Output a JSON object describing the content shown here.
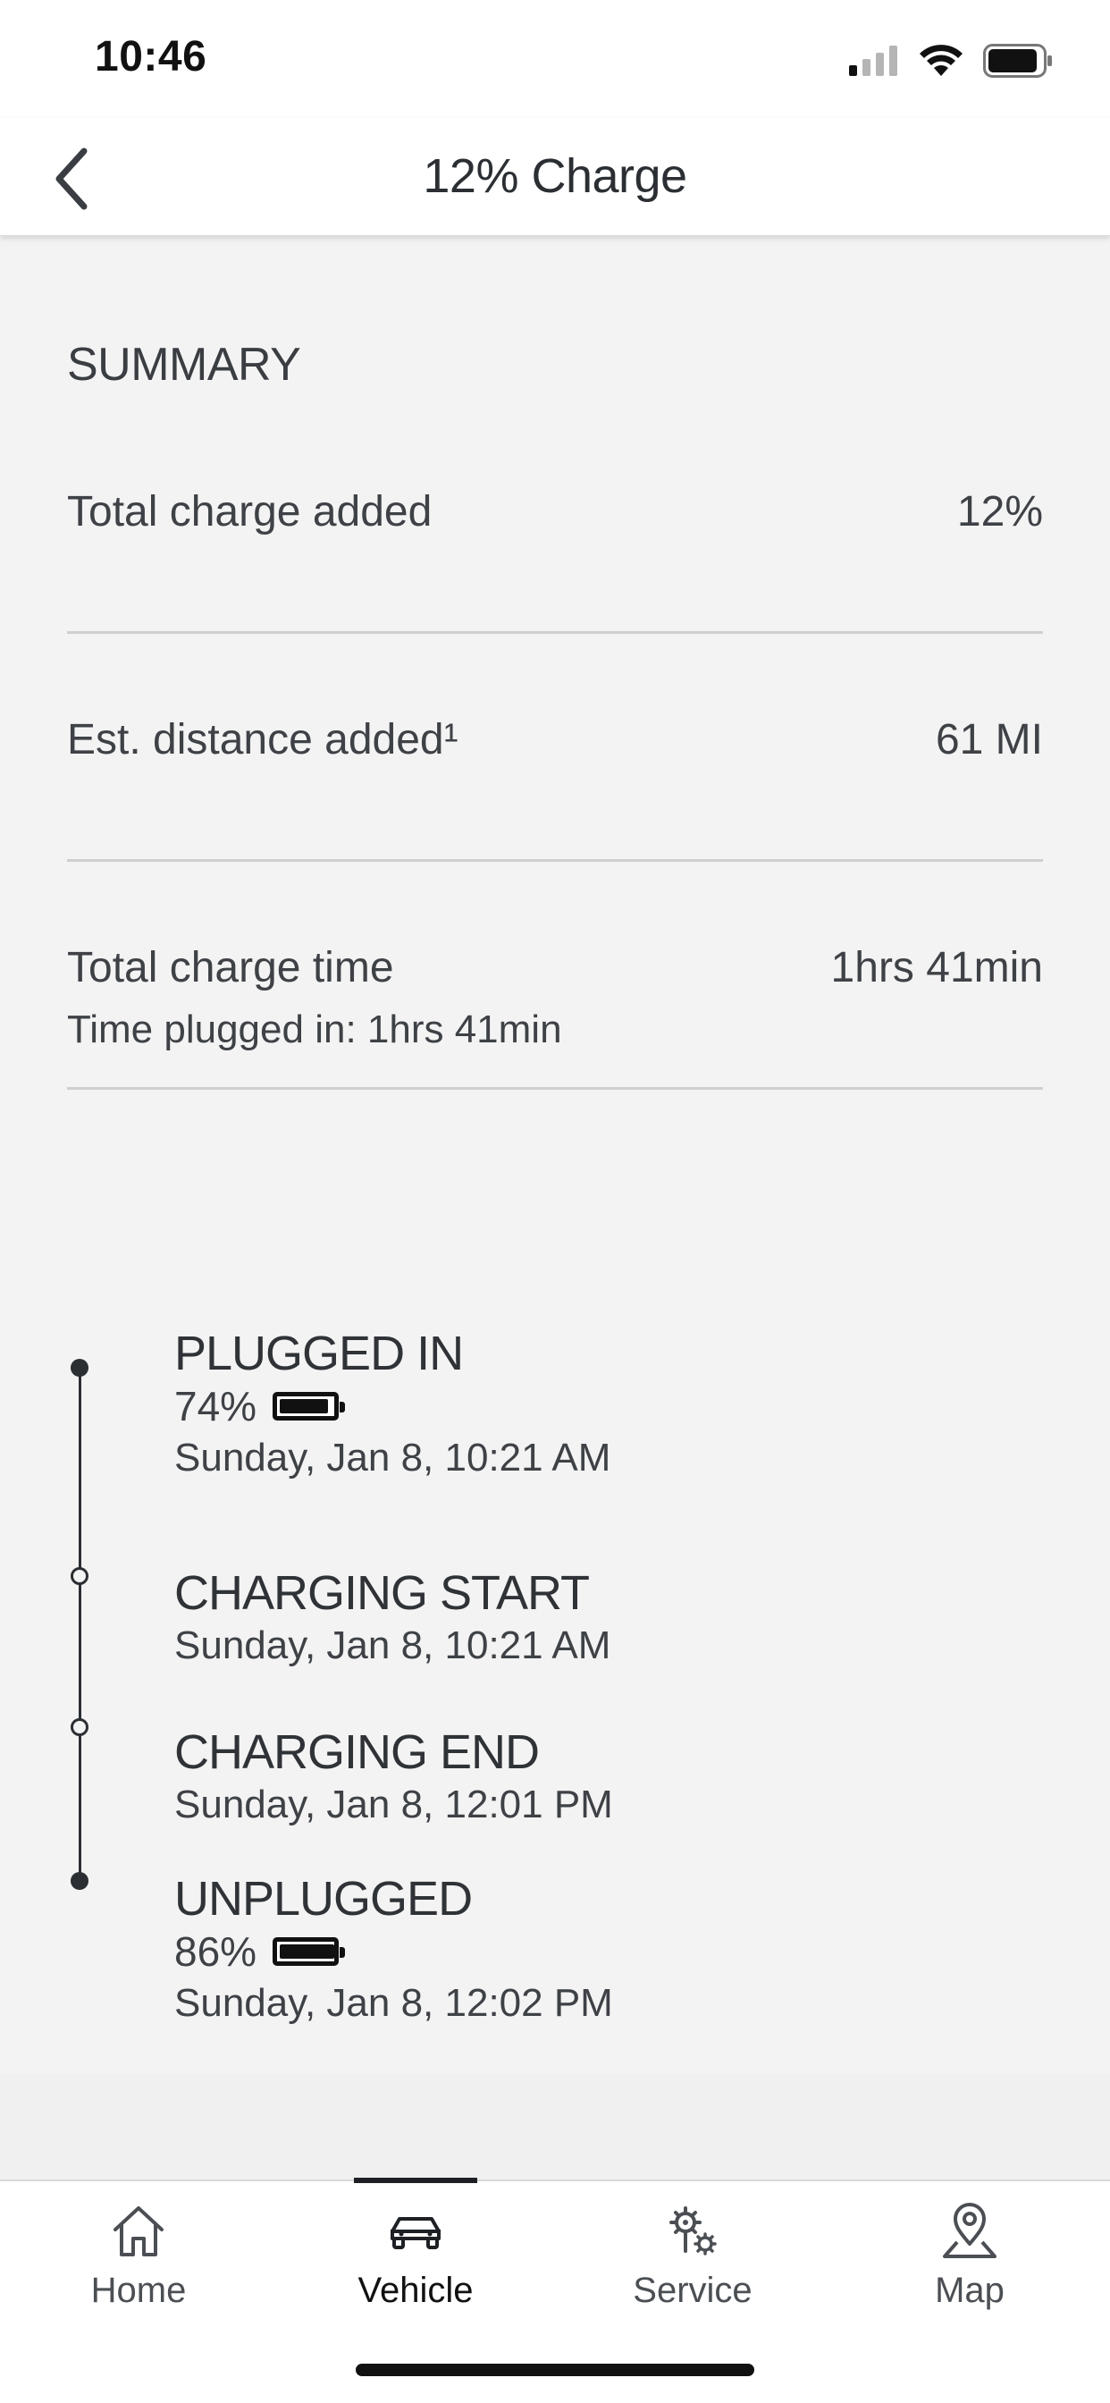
{
  "status_bar": {
    "time": "10:46",
    "icons": [
      "signal-icon",
      "wifi-icon",
      "battery-icon"
    ]
  },
  "header": {
    "title": "12% Charge",
    "back_icon": "chevron-left-icon"
  },
  "summary": {
    "title": "SUMMARY",
    "rows": [
      {
        "label": "Total charge added",
        "value": "12%"
      },
      {
        "label": "Est. distance added¹",
        "value": "61 MI"
      },
      {
        "label": "Total charge time",
        "value": "1hrs 41min",
        "sub": "Time plugged in: 1hrs 41min"
      }
    ]
  },
  "timeline": [
    {
      "title": "PLUGGED IN",
      "percent": "74%",
      "battery_level": 0.74,
      "time": "Sunday, Jan 8, 10:21 AM",
      "marker": "filled"
    },
    {
      "title": "CHARGING START",
      "time": "Sunday, Jan 8, 10:21 AM",
      "marker": "hollow"
    },
    {
      "title": "CHARGING END",
      "time": "Sunday, Jan 8, 12:01 PM",
      "marker": "hollow"
    },
    {
      "title": "UNPLUGGED",
      "percent": "86%",
      "battery_level": 0.86,
      "time": "Sunday, Jan 8, 12:02 PM",
      "marker": "filled"
    }
  ],
  "nav": {
    "items": [
      {
        "label": "Home",
        "icon": "home-icon"
      },
      {
        "label": "Vehicle",
        "icon": "car-icon",
        "active": true
      },
      {
        "label": "Service",
        "icon": "service-gears-icon"
      },
      {
        "label": "Map",
        "icon": "map-pin-icon"
      }
    ]
  }
}
